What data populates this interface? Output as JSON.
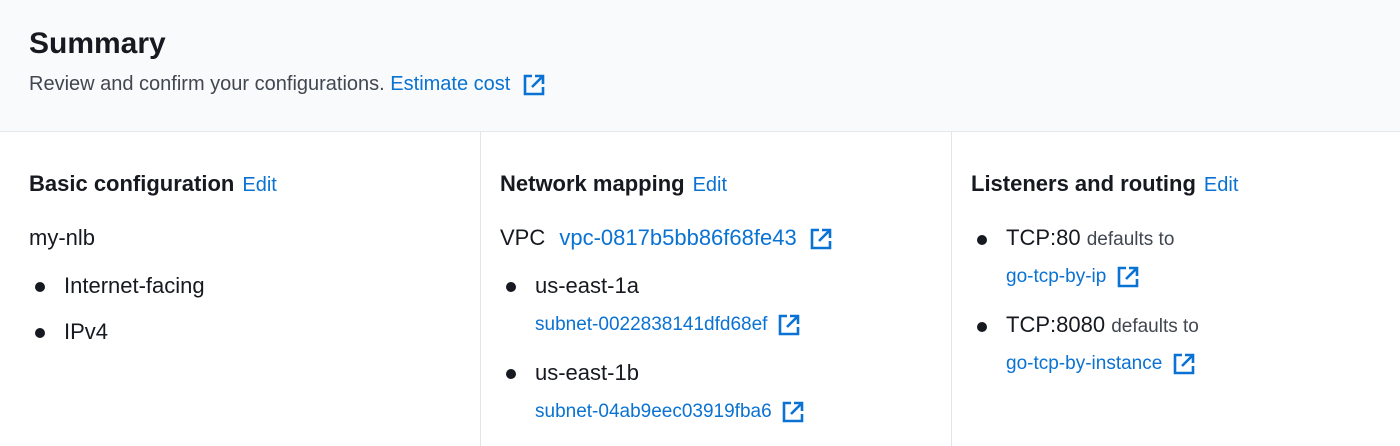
{
  "summary": {
    "title": "Summary",
    "subtitle": "Review and confirm your configurations.",
    "estimate_link": "Estimate cost"
  },
  "basic": {
    "heading": "Basic configuration",
    "edit": "Edit",
    "name": "my-nlb",
    "items": [
      "Internet-facing",
      "IPv4"
    ]
  },
  "network": {
    "heading": "Network mapping",
    "edit": "Edit",
    "vpc_label": "VPC",
    "vpc_id": "vpc-0817b5bb86f68fe43",
    "zones": [
      {
        "az": "us-east-1a",
        "subnet": "subnet-0022838141dfd68ef"
      },
      {
        "az": "us-east-1b",
        "subnet": "subnet-04ab9eec03919fba6"
      }
    ]
  },
  "listeners": {
    "heading": "Listeners and routing",
    "edit": "Edit",
    "items": [
      {
        "listener": "TCP:80",
        "defaults_text": "defaults to",
        "target": "go-tcp-by-ip"
      },
      {
        "listener": "TCP:8080",
        "defaults_text": "defaults to",
        "target": "go-tcp-by-instance"
      }
    ]
  },
  "icons": {
    "external": "external-link-icon"
  },
  "colors": {
    "link": "#0972d3",
    "text": "#16191f",
    "header_bg": "#f9fafb"
  }
}
